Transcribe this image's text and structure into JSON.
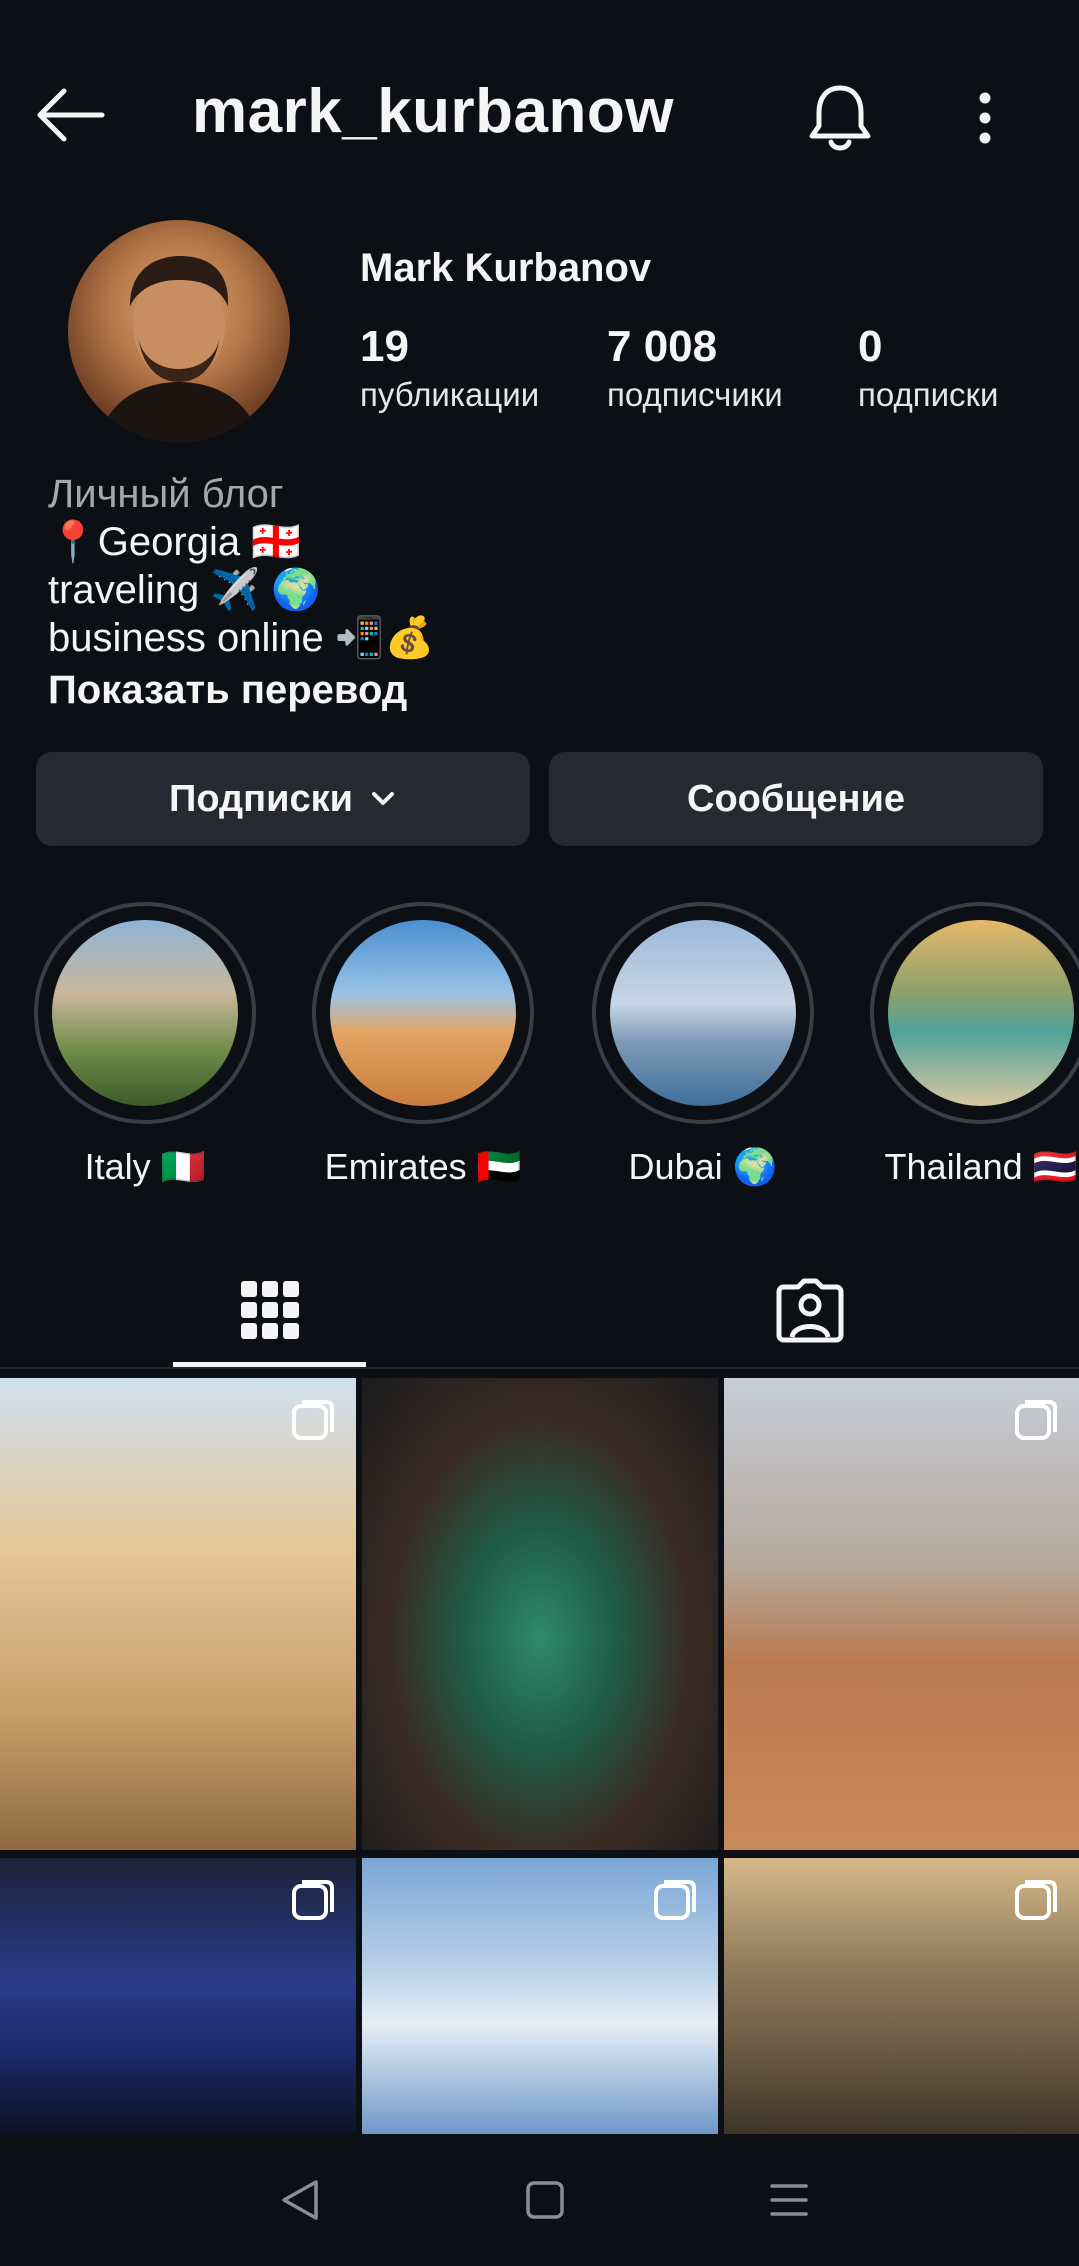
{
  "header": {
    "username": "mark_kurbanow",
    "icons": {
      "back": "arrow-left-icon",
      "notify": "bell-icon",
      "more": "more-vertical-icon"
    }
  },
  "profile": {
    "full_name": "Mark Kurbanov",
    "stats": [
      {
        "value": "19",
        "label": "публикации"
      },
      {
        "value": "7 008",
        "label": "подписчики"
      },
      {
        "value": "0",
        "label": "подписки"
      }
    ],
    "bio": {
      "category": "Личный блог",
      "lines": [
        "📍Georgia 🇬🇪",
        "traveling ✈️ 🌍",
        "business online 📲💰"
      ],
      "translate_label": "Показать перевод"
    }
  },
  "actions": {
    "following_label": "Подписки",
    "message_label": "Сообщение"
  },
  "highlights": [
    {
      "name": "Italy 🇮🇹"
    },
    {
      "name": "Emirates 🇦🇪"
    },
    {
      "name": "Dubai 🌍"
    },
    {
      "name": "Thailand 🇹🇭"
    }
  ],
  "tabs": [
    {
      "name": "posts-grid",
      "icon": "grid-icon",
      "active": true
    },
    {
      "name": "tagged",
      "icon": "tagged-person-icon",
      "active": false
    }
  ],
  "posts": [
    {
      "multiple": true
    },
    {
      "multiple": false
    },
    {
      "multiple": true
    },
    {
      "multiple": true
    },
    {
      "multiple": true
    },
    {
      "multiple": true
    }
  ],
  "navbar": {
    "icons": [
      "back-triangle-icon",
      "home-square-icon",
      "menu-lines-icon"
    ]
  },
  "colors": {
    "background": "#0c1014",
    "button": "#262a30",
    "text": "#f5f5f5",
    "muted": "#a8a8a8"
  }
}
